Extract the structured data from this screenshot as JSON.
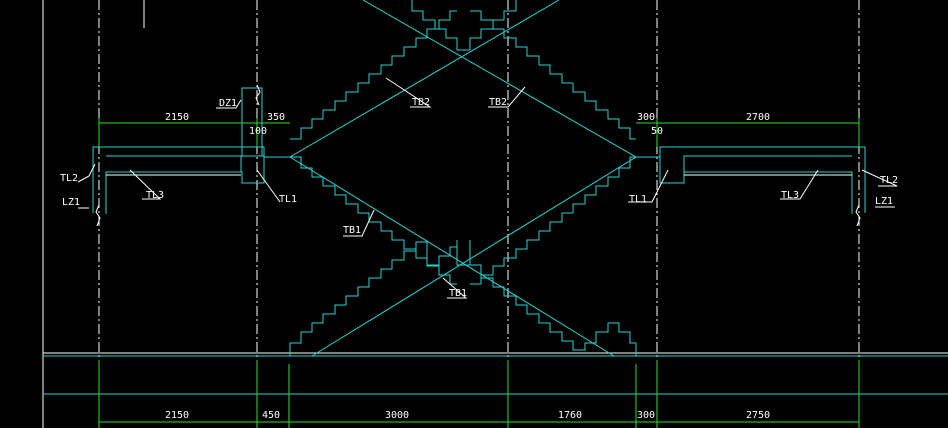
{
  "colors": {
    "background": "#000000",
    "structure": "#27d3d3",
    "dimension": "#27e027",
    "annotation": "#ffffff"
  },
  "dimensions": {
    "top_left": "2150",
    "top_left_small": "350",
    "top_left_inner": "100",
    "top_right_small": "300",
    "top_right_inner": "50",
    "top_right": "2700",
    "bottom": [
      "2150",
      "450",
      "3000",
      "1760",
      "300",
      "2750"
    ]
  },
  "labels": {
    "dz1": "DZ1",
    "tl2_left": "TL2",
    "lz1_left": "LZ1",
    "tl3_left": "TL3",
    "tl1_left": "TL1",
    "tb2_left": "TB2",
    "tb2_right": "TB2",
    "tl1_right": "TL1",
    "tl3_right": "TL3",
    "tl2_right": "TL2",
    "lz1_right": "LZ1",
    "tb1_upper": "TB1",
    "tb1_lower": "TB1"
  }
}
